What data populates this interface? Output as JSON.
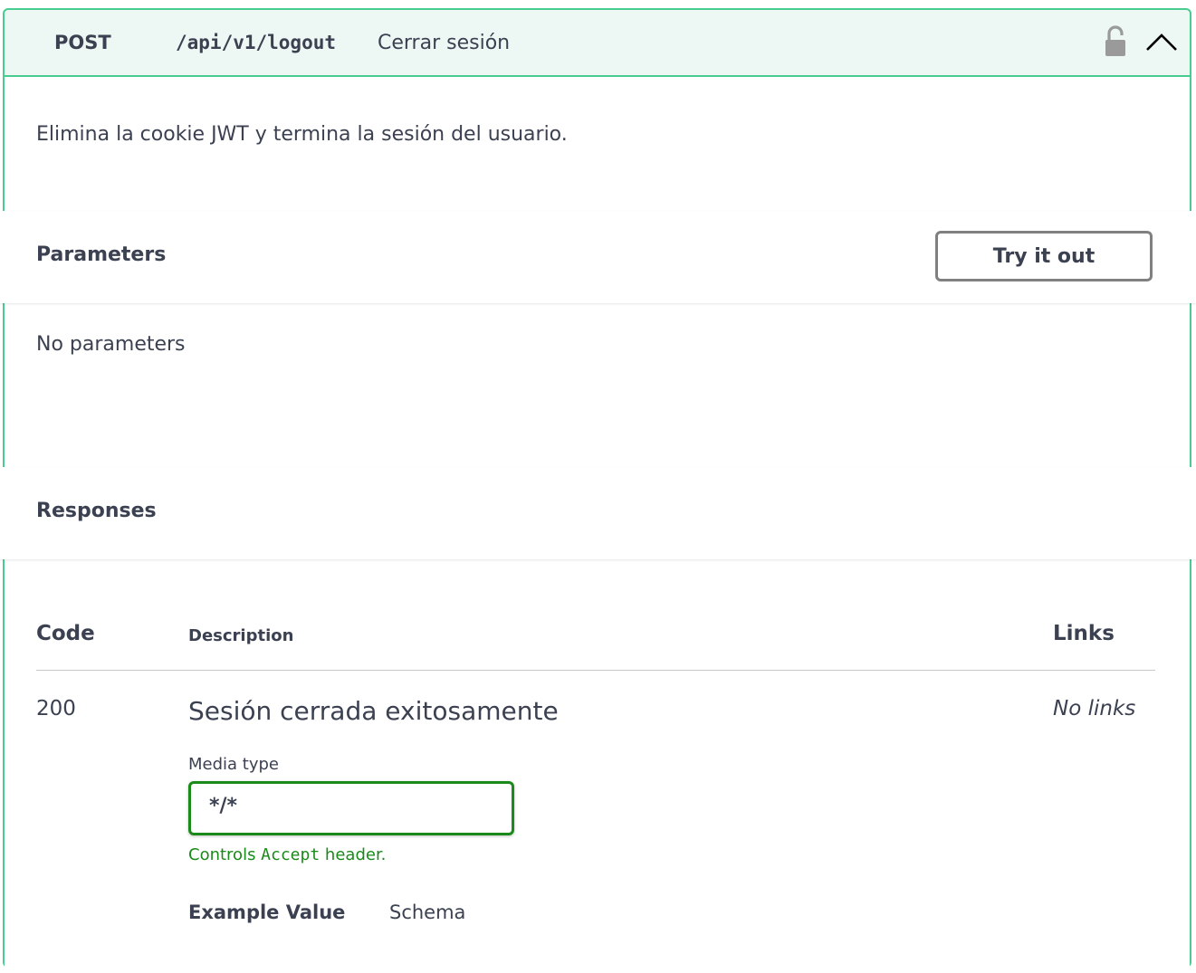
{
  "operation": {
    "method": "POST",
    "path": "/api/v1/logout",
    "summary": "Cerrar sesión",
    "description": "Elimina la cookie JWT y termina la sesión del usuario.",
    "accent_color": "#49cc90",
    "icons": {
      "lock": "lock-icon",
      "collapse": "chevron-up-icon"
    }
  },
  "parameters": {
    "title": "Parameters",
    "try_label": "Try it out",
    "empty_text": "No parameters"
  },
  "responses": {
    "title": "Responses",
    "headers": {
      "code": "Code",
      "description": "Description",
      "links": "Links"
    },
    "rows": [
      {
        "code": "200",
        "description": "Sesión cerrada exitosamente",
        "links": "No links",
        "media_type_label": "Media type",
        "media_type_value": "*/*",
        "hint_prefix": "Controls ",
        "hint_code": "Accept",
        "hint_suffix": " header.",
        "tab_example": "Example Value",
        "tab_schema": "Schema"
      }
    ]
  }
}
